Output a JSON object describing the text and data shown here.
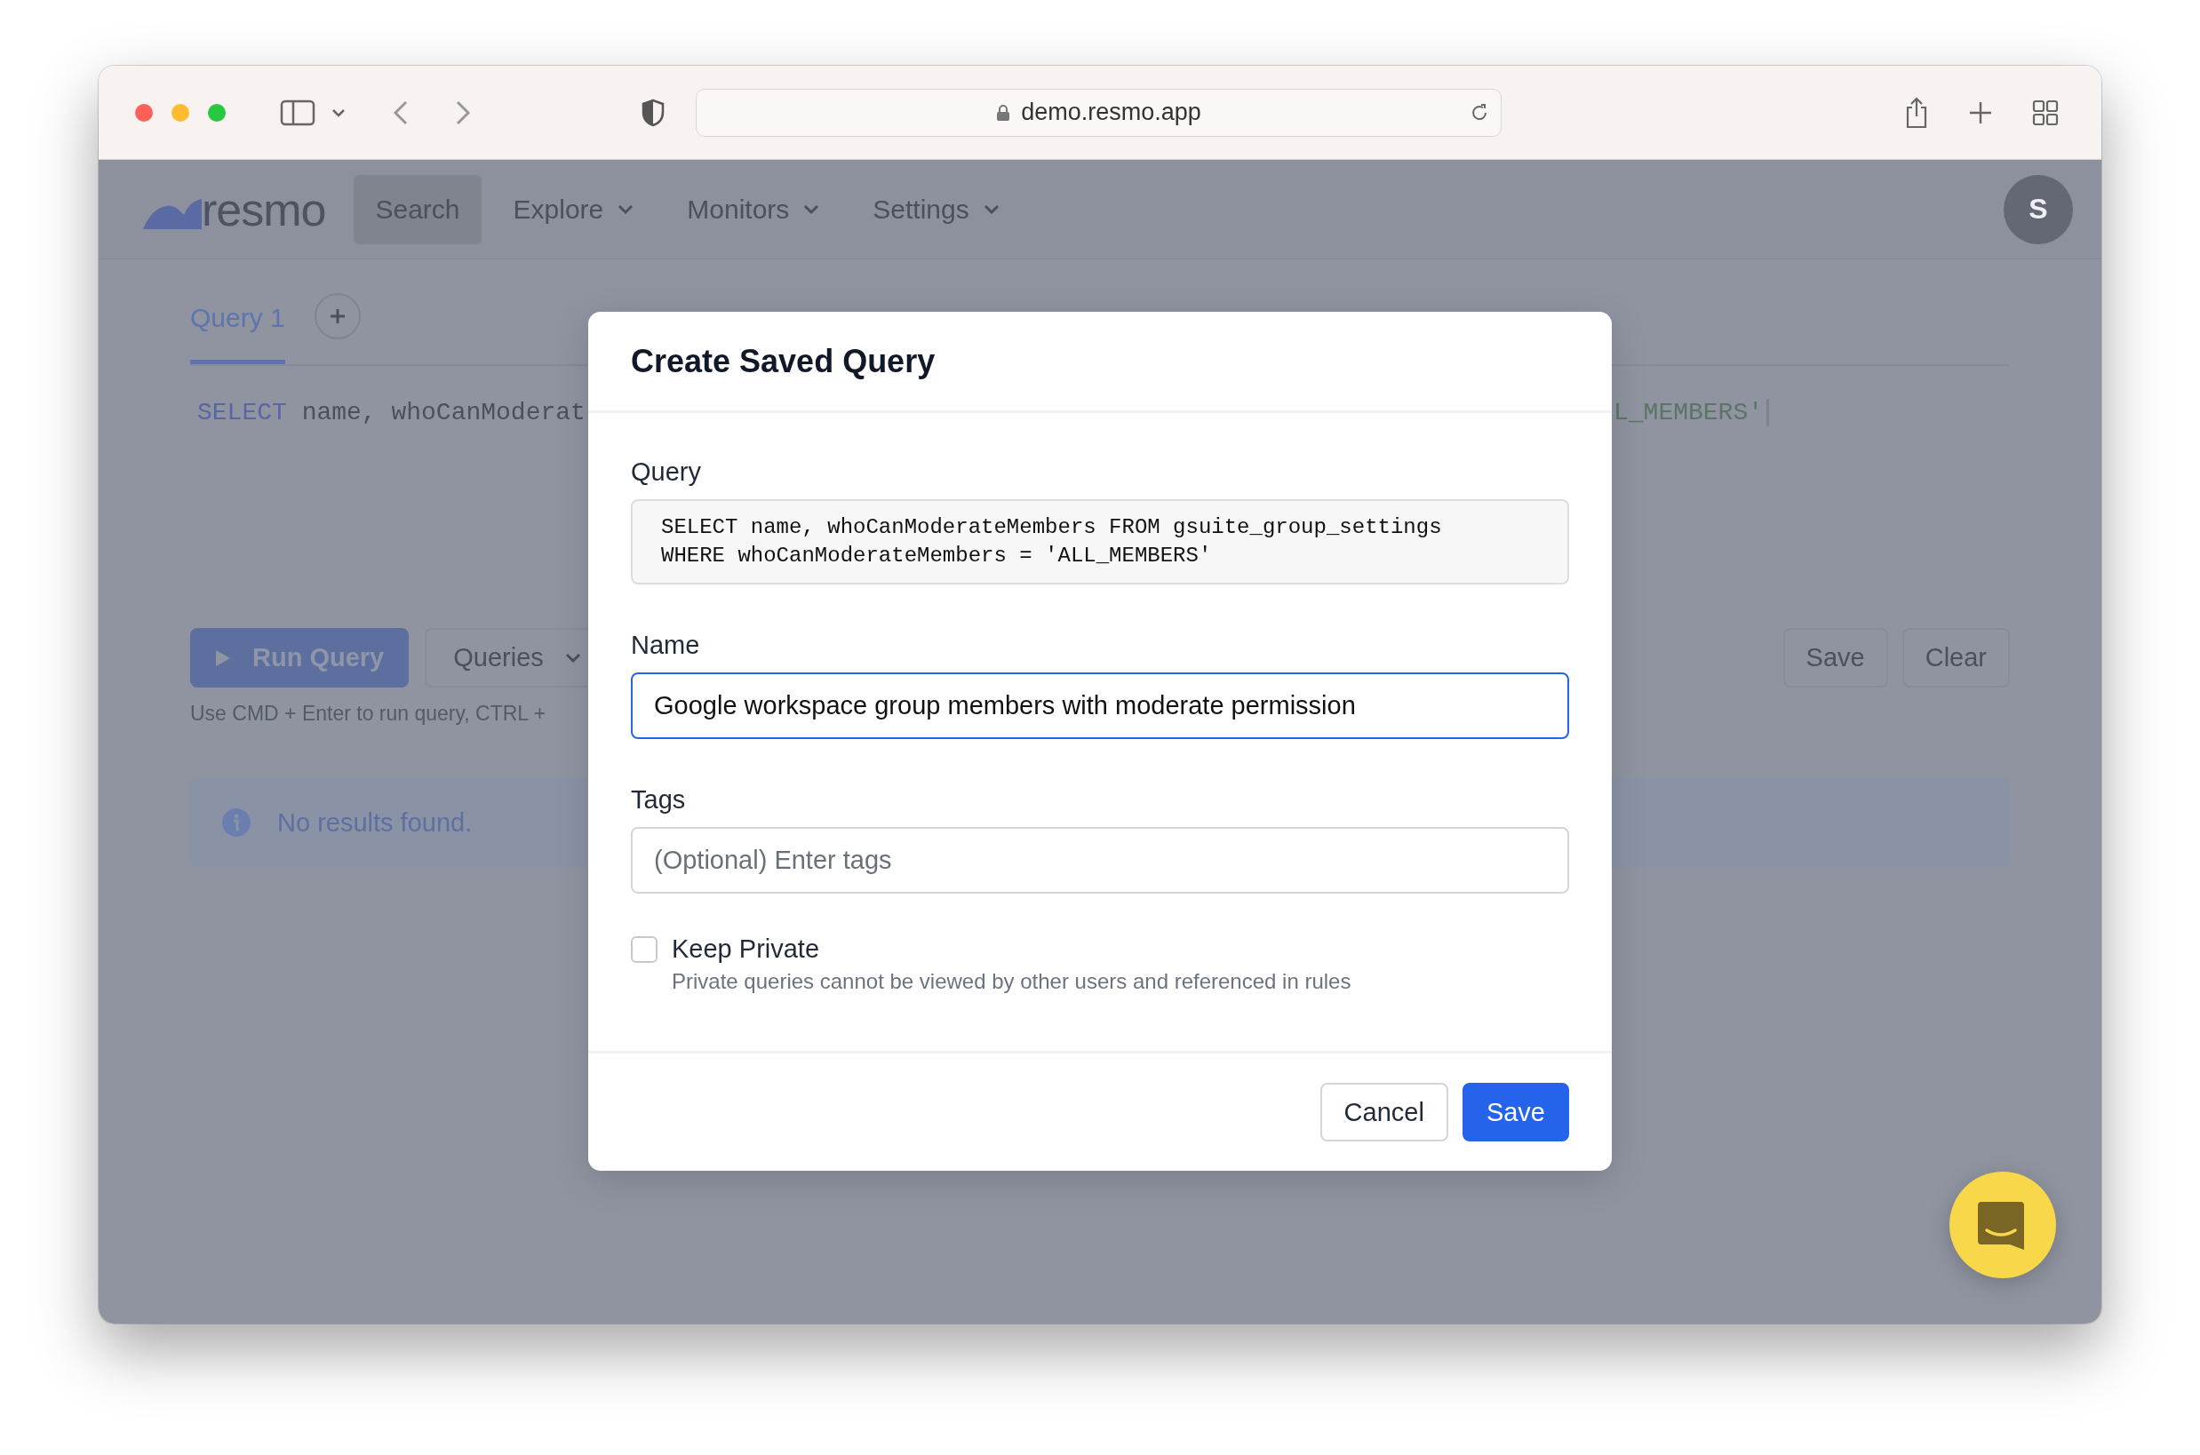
{
  "browser": {
    "url": "demo.resmo.app"
  },
  "nav": {
    "logo": "resmo",
    "items": [
      {
        "label": "Search",
        "selected": true,
        "dropdown": false
      },
      {
        "label": "Explore",
        "selected": false,
        "dropdown": true
      },
      {
        "label": "Monitors",
        "selected": false,
        "dropdown": true
      },
      {
        "label": "Settings",
        "selected": false,
        "dropdown": true
      }
    ],
    "avatar": "S"
  },
  "editor": {
    "tabs": [
      {
        "label": "Query 1",
        "selected": true
      }
    ],
    "code_left": [
      {
        "text": "SELECT",
        "kind": "keyword"
      },
      {
        "text": " name, whoCanModerat",
        "kind": "plain"
      }
    ],
    "code_right": [
      {
        "text": "L_MEMBERS'",
        "kind": "string"
      }
    ]
  },
  "toolbar": {
    "run_button": "Run Query",
    "queries_button": "Queries",
    "save_button": "Save",
    "clear_button": "Clear",
    "hint": "Use CMD + Enter to run query, CTRL +"
  },
  "alert": {
    "message": "No results found."
  },
  "modal": {
    "title": "Create Saved Query",
    "query_label": "Query",
    "query_lines": [
      "SELECT name, whoCanModerateMembers FROM gsuite_group_settings",
      "WHERE whoCanModerateMembers = 'ALL_MEMBERS'"
    ],
    "name_label": "Name",
    "name_value": "Google workspace group members with moderate permission",
    "tags_label": "Tags",
    "tags_placeholder": "(Optional) Enter tags",
    "keep_private": {
      "label": "Keep Private",
      "description": "Private queries cannot be viewed by other users and referenced in rules",
      "checked": false
    },
    "buttons": [
      {
        "label": "Cancel",
        "kind": "secondary"
      },
      {
        "label": "Save",
        "kind": "primary"
      }
    ]
  }
}
